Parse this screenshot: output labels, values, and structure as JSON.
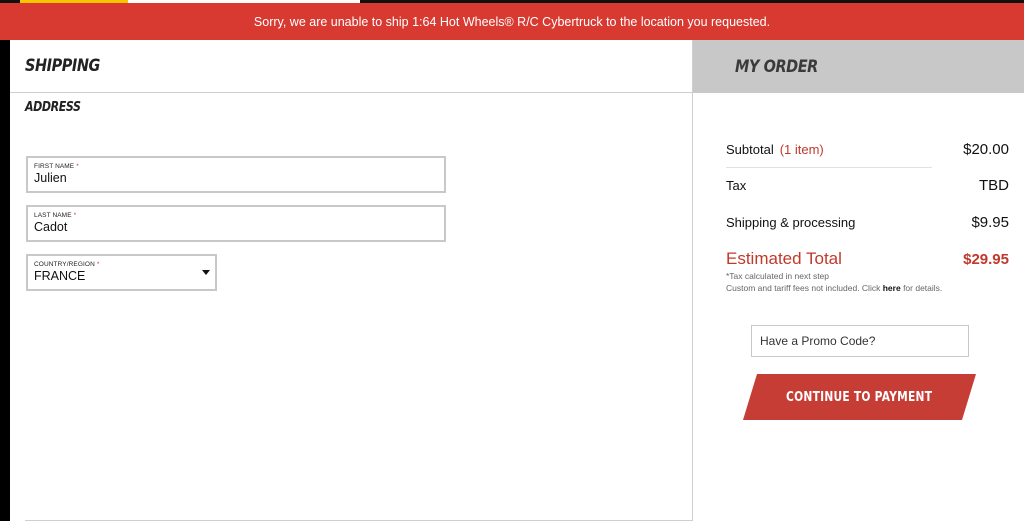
{
  "alert": {
    "message": "Sorry, we are unable to ship 1:64 Hot Wheels® R/C Cybertruck to the location you requested."
  },
  "shipping": {
    "title": "SHIPPING",
    "section": "ADDRESS",
    "first_name": {
      "label": "FIRST NAME",
      "required_mark": "*",
      "value": "Julien"
    },
    "last_name": {
      "label": "LAST NAME",
      "required_mark": "*",
      "value": "Cadot"
    },
    "country": {
      "label": "COUNTRY/REGION",
      "required_mark": "*",
      "value": "FRANCE"
    }
  },
  "order": {
    "title": "MY ORDER",
    "subtotal": {
      "label": "Subtotal",
      "count": "(1 item)",
      "value": "$20.00"
    },
    "tax": {
      "label": "Tax",
      "value": "TBD"
    },
    "shipping": {
      "label": "Shipping & processing",
      "value": "$9.95"
    },
    "total": {
      "label": "Estimated Total",
      "value": "$29.95"
    },
    "note_tax": "*Tax calculated in next step",
    "note_fees": "Custom and tariff fees not included. Click",
    "note_link": "here",
    "note_tail": "for details.",
    "promo": "Have a Promo Code?",
    "continue": "CONTINUE TO PAYMENT"
  },
  "colors": {
    "accent_red": "#d83a32",
    "button_red": "#c63d36",
    "panel_gray": "#c8c8c8"
  }
}
